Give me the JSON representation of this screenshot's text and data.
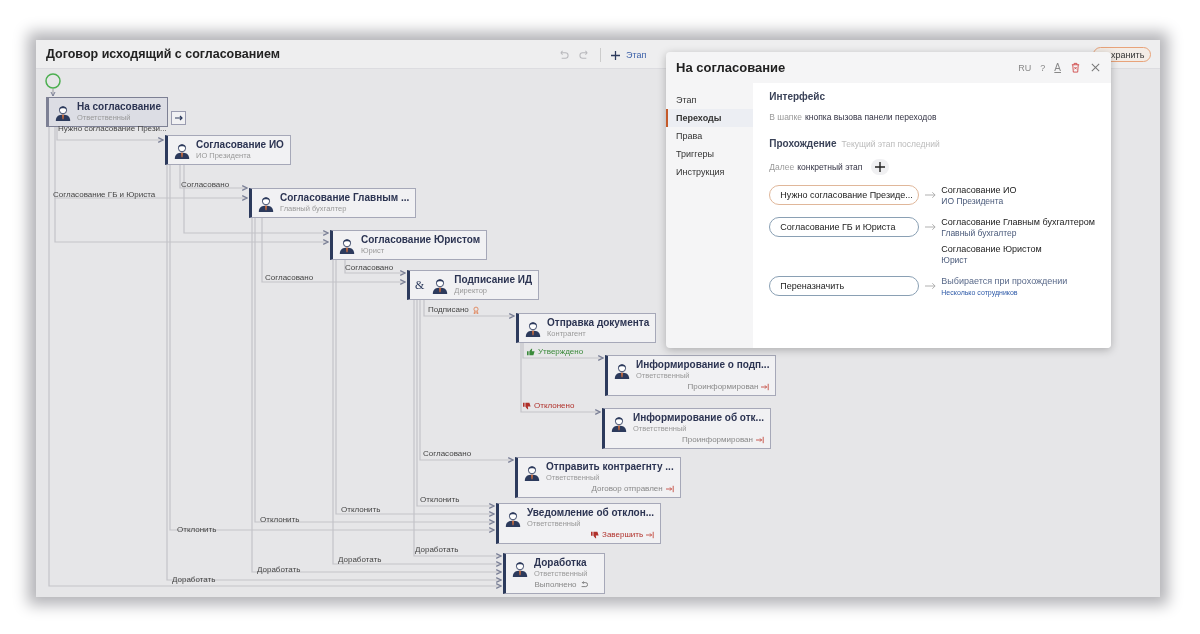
{
  "header": {
    "title": "Договор исходящий с согласованием",
    "undo": {
      "disabled": true
    },
    "redo": {
      "disabled": true
    },
    "add_stage": "Этап",
    "save_button": "хранить"
  },
  "diagram": {
    "nodes": [
      {
        "title": "На согласование",
        "role": "Ответственный",
        "selected": true
      },
      {
        "title": "Согласование ИО",
        "role": "ИО Президента",
        "selected": false
      },
      {
        "title": "Согласование Главным ...",
        "role": "Главный бухгалтер",
        "selected": false
      },
      {
        "title": "Согласование Юристом",
        "role": "Юрист",
        "selected": false
      },
      {
        "title": "Подписание ИД",
        "role": "Директор",
        "selected": false,
        "join_mark": "&"
      },
      {
        "title": "Отправка документа",
        "role": "Контрагент",
        "selected": false
      },
      {
        "title": "Информирование о подп...",
        "role": "Ответственный",
        "selected": false,
        "action": {
          "label": "Проинформирован",
          "kind": "exit"
        }
      },
      {
        "title": "Информирование об отк...",
        "role": "Ответственный",
        "selected": false,
        "action": {
          "label": "Проинформирован",
          "kind": "exit"
        }
      },
      {
        "title": "Отправить контраегнту ...",
        "role": "Ответственный",
        "selected": false,
        "action": {
          "label": "Договор отправлен",
          "kind": "exit"
        }
      },
      {
        "title": "Уведомление об отклон...",
        "role": "Ответственный",
        "selected": false,
        "action": {
          "label": "Завершить",
          "kind": "finish"
        }
      },
      {
        "title": "Доработка",
        "role": "Ответственный",
        "selected": false,
        "action": {
          "label": "Выполнено",
          "kind": "return"
        }
      }
    ],
    "edge_labels": [
      {
        "text": "Нужно согласование Прези...",
        "kind": "plain"
      },
      {
        "text": "Согласование ГБ и Юриста",
        "kind": "plain"
      },
      {
        "text": "Согласовано",
        "kind": "plain"
      },
      {
        "text": "Согласовано",
        "kind": "plain"
      },
      {
        "text": "Согласовано",
        "kind": "plain"
      },
      {
        "text": "Подписано",
        "kind": "signed"
      },
      {
        "text": "Утверждено",
        "kind": "approved"
      },
      {
        "text": "Отклонено",
        "kind": "rejected"
      },
      {
        "text": "Согласовано",
        "kind": "plain"
      },
      {
        "text": "Отклонить",
        "kind": "plain"
      },
      {
        "text": "Отклонить",
        "kind": "plain"
      },
      {
        "text": "Отклонить",
        "kind": "plain"
      },
      {
        "text": "Отклонить",
        "kind": "plain"
      },
      {
        "text": "Доработать",
        "kind": "plain"
      },
      {
        "text": "Доработать",
        "kind": "plain"
      },
      {
        "text": "Доработать",
        "kind": "plain"
      },
      {
        "text": "Доработать",
        "kind": "plain"
      }
    ]
  },
  "panel": {
    "title": "На согласование",
    "language": "RU",
    "help": "?",
    "font_tool": "A",
    "tabs": [
      {
        "label": "Этап",
        "selected": false
      },
      {
        "label": "Переходы",
        "selected": true
      },
      {
        "label": "Права",
        "selected": false
      },
      {
        "label": "Триггеры",
        "selected": false
      },
      {
        "label": "Инструкция",
        "selected": false
      }
    ],
    "interface": {
      "heading": "Интерфейс",
      "label": "В шапке",
      "value": "кнопка вызова панели переходов"
    },
    "passage": {
      "heading": "Прохождение",
      "hint": "Текущий этап последний",
      "next_label": "Далее",
      "next_value": "конкретный этап"
    },
    "transitions": [
      {
        "button": "Нужно согласование Президе...",
        "selected": true,
        "targets": [
          {
            "kind": "stage",
            "name": "Согласование ИО",
            "role": "ИО Президента"
          }
        ]
      },
      {
        "button": "Согласование ГБ и Юриста",
        "selected": false,
        "targets": [
          {
            "kind": "stage",
            "name": "Согласование Главным бухгалтером",
            "role": "Главный бухгалтер"
          },
          {
            "kind": "stage",
            "name": "Согласование Юристом",
            "role": "Юрист"
          }
        ]
      },
      {
        "button": "Переназначить",
        "selected": false,
        "targets": [
          {
            "kind": "dynamic",
            "name": "Выбирается при прохождении",
            "role": "Несколько сотрудников"
          }
        ]
      }
    ]
  }
}
